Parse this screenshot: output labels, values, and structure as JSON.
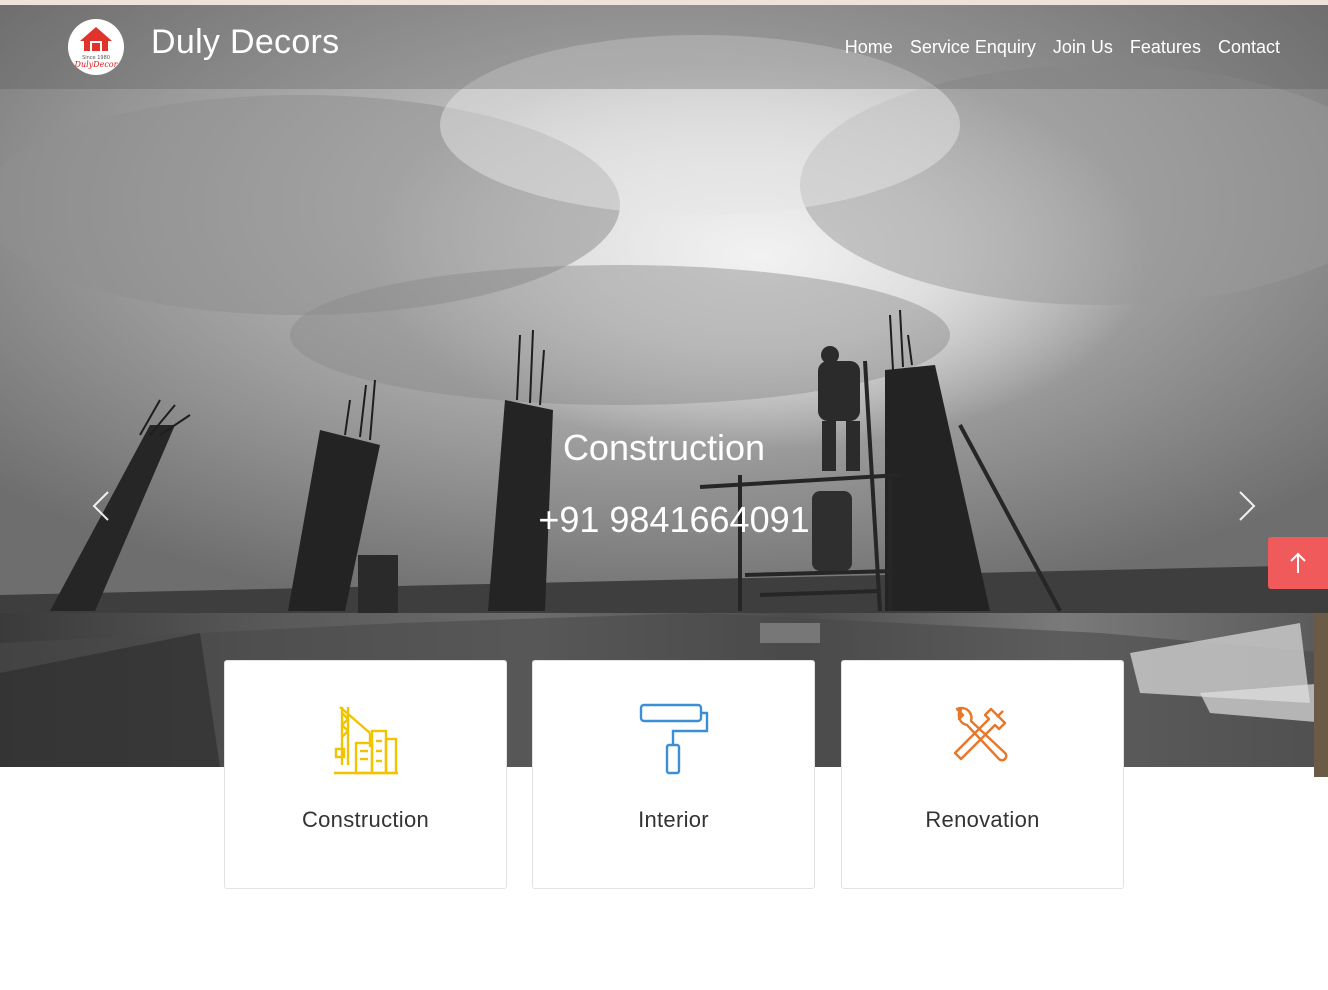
{
  "brand": {
    "name": "Duly Decors",
    "logo_text_top": "Since 1980",
    "logo_text_main": "DulyDecor"
  },
  "nav": {
    "items": [
      "Home",
      "Service Enquiry",
      "Join Us",
      "Features",
      "Contact"
    ]
  },
  "hero": {
    "title": "Construction",
    "phone": "+91 9841664091"
  },
  "icons": {
    "prev": "chevron-left-icon",
    "next": "chevron-right-icon",
    "scroll_top": "arrow-up-icon"
  },
  "services": [
    {
      "label": "Construction",
      "icon": "crane-building-icon",
      "color": "#f2c400"
    },
    {
      "label": "Interior",
      "icon": "paint-roller-icon",
      "color": "#3a8fd6"
    },
    {
      "label": "Renovation",
      "icon": "wrench-hammer-icon",
      "color": "#e8772a"
    }
  ],
  "colors": {
    "scroll_top_bg": "#f15a5a"
  }
}
